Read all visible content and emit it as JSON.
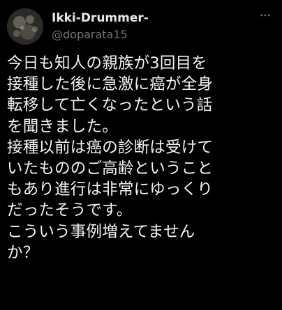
{
  "tweet": {
    "author": {
      "display_name": "Ikki-Drummer-",
      "handle": "@doparata15"
    },
    "text_lines": [
      "今日も知人の親族が3回目を",
      "接種した後に急激に癌が全身",
      "転移して亡くなったという話",
      "を聞きました。",
      "接種以前は癌の診断は受けて",
      "いたもののご高齢ということ",
      "もあり進行は非常にゆっくり",
      "だったそうです。",
      "こういう事例増えてません",
      "か？"
    ],
    "icons": {
      "more": "more-options-icon",
      "avatar": "avatar-image"
    }
  },
  "colors": {
    "background": "#000000",
    "text_primary": "#e7e9ea",
    "text_secondary": "#71767b"
  }
}
